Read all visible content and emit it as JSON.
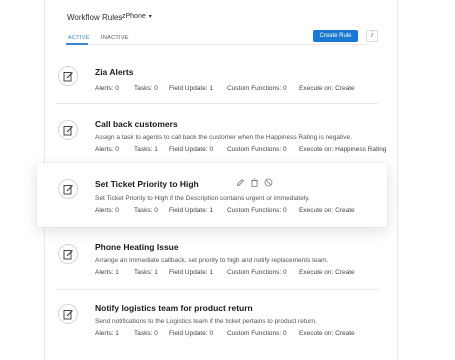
{
  "header": {
    "title": "Workflow Rules",
    "department": "zPhone",
    "create_button": "Create Rule",
    "info_button": "i"
  },
  "tabs": [
    {
      "label": "ACTIVE",
      "active": true
    },
    {
      "label": "INACTIVE",
      "active": false
    }
  ],
  "colors": {
    "accent": "#1b78d2",
    "tab_active": "#3a86d6"
  },
  "rules": [
    {
      "name": "Zia Alerts",
      "description": "",
      "alerts": "Alerts: 0",
      "tasks": "Tasks: 0",
      "field_update": "Field Update: 1",
      "custom_functions": "Custom Functions: 0",
      "execute_on": "Execute on: Create"
    },
    {
      "name": "Call back customers",
      "description": "Assign a task to agents to call back the customer when the Happiness Rating is negative.",
      "alerts": "Alerts: 0",
      "tasks": "Tasks: 1",
      "field_update": "Field Update: 0",
      "custom_functions": "Custom Functions: 0",
      "execute_on": "Execute on: Happiness Rating"
    },
    {
      "name": "Set Ticket Priority to High",
      "description": "Set Ticket Priority to High if the Description contains urgent or immediately.",
      "alerts": "Alerts: 0",
      "tasks": "Tasks: 0",
      "field_update": "Field Update: 1",
      "custom_functions": "Custom Functions: 0",
      "execute_on": "Execute on: Create",
      "highlighted": true
    },
    {
      "name": "Phone Heating Issue",
      "description": "Arrange an Immediate callback, set priority to high and notify replacements team.",
      "alerts": "Alerts: 1",
      "tasks": "Tasks: 1",
      "field_update": "Field Update: 1",
      "custom_functions": "Custom Functions: 0",
      "execute_on": "Execute on: Create"
    },
    {
      "name": "Notify logistics team for product return",
      "description": "Send notifications to the Logistics team if the ticket pertains to product return.",
      "alerts": "Alerts: 1",
      "tasks": "Tasks: 0",
      "field_update": "Field Update: 0",
      "custom_functions": "Custom Functions: 0",
      "execute_on": "Execute on: Create"
    }
  ],
  "icons": {
    "rule": "edit-document-icon",
    "actions": [
      "pencil-icon",
      "trash-icon",
      "disable-icon"
    ]
  }
}
